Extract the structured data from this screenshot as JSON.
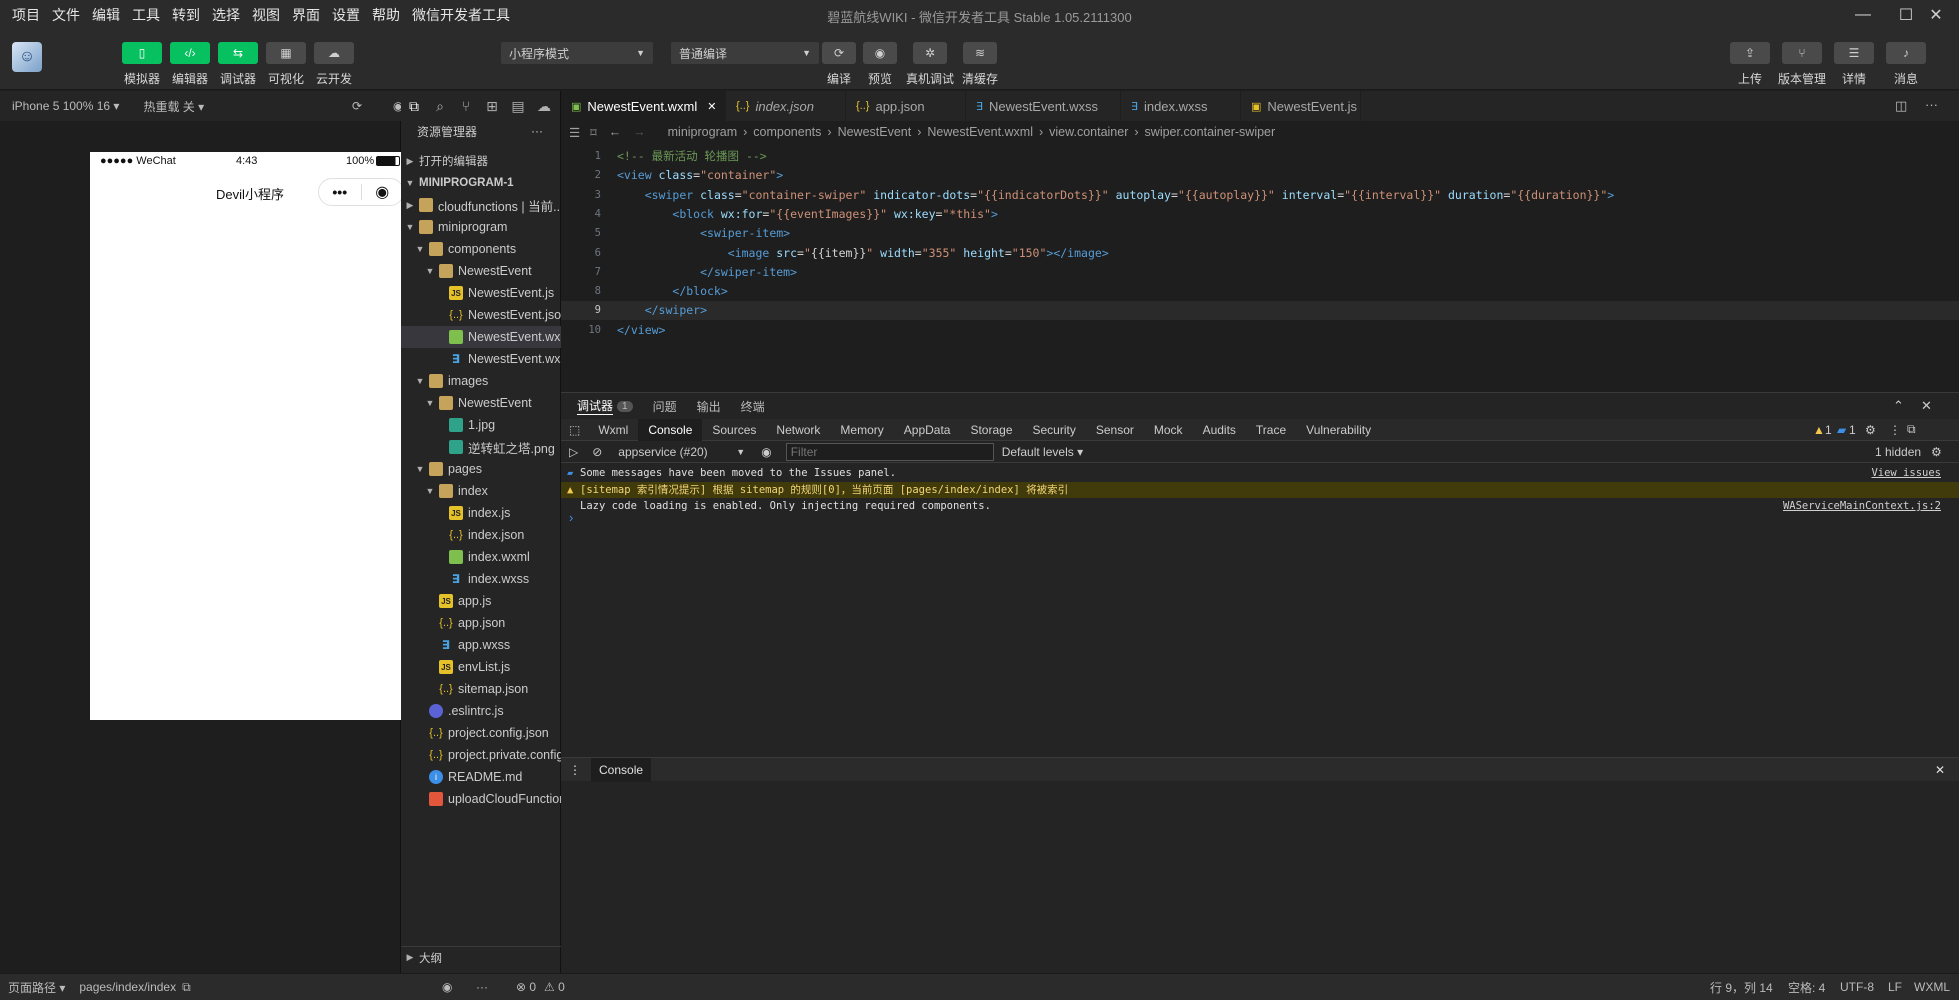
{
  "window": {
    "title": "碧蓝航线WIKI - 微信开发者工具 Stable 1.05.2111300",
    "menu": [
      "项目",
      "文件",
      "编辑",
      "工具",
      "转到",
      "选择",
      "视图",
      "界面",
      "设置",
      "帮助",
      "微信开发者工具"
    ]
  },
  "toolbar": {
    "left_buttons": [
      {
        "label": "模拟器",
        "icon": "phone-icon"
      },
      {
        "label": "编辑器",
        "icon": "code-icon"
      },
      {
        "label": "调试器",
        "icon": "debug-icon"
      },
      {
        "label": "可视化",
        "icon": "layout-icon"
      },
      {
        "label": "云开发",
        "icon": "cloud-icon"
      }
    ],
    "mode_select": "小程序模式",
    "compile_select": "普通编译",
    "center_buttons": [
      {
        "label": "编译",
        "icon": "refresh-icon"
      },
      {
        "label": "预览",
        "icon": "eye-icon"
      },
      {
        "label": "真机调试",
        "icon": "bug-icon"
      },
      {
        "label": "清缓存",
        "icon": "layers-icon"
      }
    ],
    "right_buttons": [
      {
        "label": "上传",
        "icon": "upload-icon"
      },
      {
        "label": "版本管理",
        "icon": "branch-icon"
      },
      {
        "label": "详情",
        "icon": "menu-icon"
      },
      {
        "label": "消息",
        "icon": "bell-icon"
      }
    ]
  },
  "simulator": {
    "device": "iPhone 5 100% 16 ▾",
    "hot_reload": "热重载 关 ▾",
    "status_signal": "●●●●● WeChat",
    "status_time": "4:43",
    "status_battery": "100%",
    "nav_title": "Devil小程序",
    "capsule_dots": "•••"
  },
  "explorer": {
    "title": "资源管理器",
    "more": "···",
    "open_editors": "打开的编辑器",
    "project": "MINIPROGRAM-1",
    "outline": "大纲",
    "tree": [
      {
        "name": "cloudfunctions | 当前...",
        "type": "folder",
        "depth": 1,
        "open": false
      },
      {
        "name": "miniprogram",
        "type": "folder",
        "depth": 1,
        "open": true
      },
      {
        "name": "components",
        "type": "folder",
        "depth": 2,
        "open": true
      },
      {
        "name": "NewestEvent",
        "type": "folder",
        "depth": 3,
        "open": true
      },
      {
        "name": "NewestEvent.js",
        "type": "js",
        "depth": 4
      },
      {
        "name": "NewestEvent.json",
        "type": "json",
        "depth": 4
      },
      {
        "name": "NewestEvent.wxml",
        "type": "wxml",
        "depth": 4,
        "selected": true
      },
      {
        "name": "NewestEvent.wxss",
        "type": "wxss",
        "depth": 4
      },
      {
        "name": "images",
        "type": "folder",
        "depth": 2,
        "open": true
      },
      {
        "name": "NewestEvent",
        "type": "folder",
        "depth": 3,
        "open": true
      },
      {
        "name": "1.jpg",
        "type": "img",
        "depth": 4
      },
      {
        "name": "逆转虹之塔.png",
        "type": "img",
        "depth": 4
      },
      {
        "name": "pages",
        "type": "folder",
        "depth": 2,
        "open": true
      },
      {
        "name": "index",
        "type": "folder",
        "depth": 3,
        "open": true
      },
      {
        "name": "index.js",
        "type": "js",
        "depth": 4
      },
      {
        "name": "index.json",
        "type": "json",
        "depth": 4
      },
      {
        "name": "index.wxml",
        "type": "wxml",
        "depth": 4
      },
      {
        "name": "index.wxss",
        "type": "wxss",
        "depth": 4
      },
      {
        "name": "app.js",
        "type": "js",
        "depth": 3
      },
      {
        "name": "app.json",
        "type": "json",
        "depth": 3
      },
      {
        "name": "app.wxss",
        "type": "wxss",
        "depth": 3
      },
      {
        "name": "envList.js",
        "type": "js",
        "depth": 3
      },
      {
        "name": "sitemap.json",
        "type": "json",
        "depth": 3
      },
      {
        "name": ".eslintrc.js",
        "type": "eslint",
        "depth": 2
      },
      {
        "name": "project.config.json",
        "type": "json",
        "depth": 2
      },
      {
        "name": "project.private.config.js...",
        "type": "json",
        "depth": 2
      },
      {
        "name": "README.md",
        "type": "info",
        "depth": 2
      },
      {
        "name": "uploadCloudFunction....",
        "type": "html",
        "depth": 2
      }
    ]
  },
  "editor": {
    "tabs": [
      {
        "name": "NewestEvent.wxml",
        "type": "wxml",
        "active": true,
        "close": "✕"
      },
      {
        "name": "index.json",
        "type": "json",
        "italic": true
      },
      {
        "name": "app.json",
        "type": "json"
      },
      {
        "name": "NewestEvent.wxss",
        "type": "wxss"
      },
      {
        "name": "index.wxss",
        "type": "wxss"
      },
      {
        "name": "NewestEvent.js",
        "type": "js"
      }
    ],
    "breadcrumb": [
      "miniprogram",
      "components",
      "NewestEvent",
      "NewestEvent.wxml",
      "view.container",
      "swiper.container-swiper"
    ],
    "lines": [
      {
        "n": "1",
        "tokens": [
          [
            "c-com",
            "<!-- 最新活动 轮播图 -->"
          ]
        ]
      },
      {
        "n": "2",
        "tokens": [
          [
            "c-tag",
            "<view "
          ],
          [
            "c-attr",
            "class"
          ],
          [
            "c-txt",
            "="
          ],
          [
            "c-str",
            "\"container\""
          ],
          [
            "c-tag",
            ">"
          ]
        ]
      },
      {
        "n": "3",
        "tokens": [
          [
            "c-txt",
            "    "
          ],
          [
            "c-tag",
            "<swiper "
          ],
          [
            "c-attr",
            "class"
          ],
          [
            "c-txt",
            "="
          ],
          [
            "c-str",
            "\"container-swiper\""
          ],
          [
            "c-txt",
            " "
          ],
          [
            "c-attr",
            "indicator-dots"
          ],
          [
            "c-txt",
            "="
          ],
          [
            "c-str",
            "\"{{indicatorDots}}\""
          ],
          [
            "c-txt",
            " "
          ],
          [
            "c-attr",
            "autoplay"
          ],
          [
            "c-txt",
            "="
          ],
          [
            "c-str",
            "\"{{autoplay}}\""
          ],
          [
            "c-txt",
            " "
          ],
          [
            "c-attr",
            "interval"
          ],
          [
            "c-txt",
            "="
          ],
          [
            "c-str",
            "\"{{interval}}\""
          ],
          [
            "c-txt",
            " "
          ],
          [
            "c-attr",
            "duration"
          ],
          [
            "c-txt",
            "="
          ],
          [
            "c-str",
            "\"{{duration}}\""
          ],
          [
            "c-tag",
            ">"
          ]
        ]
      },
      {
        "n": "4",
        "tokens": [
          [
            "c-txt",
            "        "
          ],
          [
            "c-tag",
            "<block "
          ],
          [
            "c-attr",
            "wx:for"
          ],
          [
            "c-txt",
            "="
          ],
          [
            "c-str",
            "\"{{eventImages}}\""
          ],
          [
            "c-txt",
            " "
          ],
          [
            "c-attr",
            "wx:key"
          ],
          [
            "c-txt",
            "="
          ],
          [
            "c-str",
            "\"*this\""
          ],
          [
            "c-tag",
            ">"
          ]
        ]
      },
      {
        "n": "5",
        "tokens": [
          [
            "c-txt",
            "            "
          ],
          [
            "c-tag",
            "<swiper-item>"
          ]
        ]
      },
      {
        "n": "6",
        "tokens": [
          [
            "c-txt",
            "                "
          ],
          [
            "c-tag",
            "<image "
          ],
          [
            "c-attr",
            "src"
          ],
          [
            "c-txt",
            "="
          ],
          [
            "c-str",
            "\""
          ],
          [
            "c-txt",
            "{{item}}"
          ],
          [
            "c-str",
            "\""
          ],
          [
            "c-txt",
            " "
          ],
          [
            "c-attr",
            "width"
          ],
          [
            "c-txt",
            "="
          ],
          [
            "c-str",
            "\"355\""
          ],
          [
            "c-txt",
            " "
          ],
          [
            "c-attr",
            "height"
          ],
          [
            "c-txt",
            "="
          ],
          [
            "c-str",
            "\"150\""
          ],
          [
            "c-tag",
            "></image>"
          ]
        ]
      },
      {
        "n": "7",
        "tokens": [
          [
            "c-txt",
            "            "
          ],
          [
            "c-tag",
            "</swiper-item>"
          ]
        ]
      },
      {
        "n": "8",
        "tokens": [
          [
            "c-txt",
            "        "
          ],
          [
            "c-tag",
            "</block>"
          ]
        ]
      },
      {
        "n": "9",
        "tokens": [
          [
            "c-txt",
            "    "
          ],
          [
            "c-tag",
            "</swiper>"
          ]
        ]
      },
      {
        "n": "10",
        "tokens": [
          [
            "c-tag",
            "</view>"
          ]
        ]
      }
    ]
  },
  "debugger": {
    "tabs": [
      "调试器",
      "问题",
      "输出",
      "终端"
    ],
    "badge": "1",
    "devtools_tabs": [
      "Wxml",
      "Console",
      "Sources",
      "Network",
      "Memory",
      "AppData",
      "Storage",
      "Security",
      "Sensor",
      "Mock",
      "Audits",
      "Trace",
      "Vulnerability"
    ],
    "warn_count": "1",
    "info_count": "1",
    "context": "appservice (#20)",
    "filter_placeholder": "Filter",
    "levels": "Default levels ▾",
    "hidden": "1 hidden",
    "messages": [
      {
        "text": "Some messages have been moved to the Issues panel.",
        "link": "View issues",
        "level": "info"
      },
      {
        "text": "[sitemap 索引情况提示] 根据 sitemap 的规则[0]，当前页面 [pages/index/index] 将被索引",
        "link": "",
        "level": "warn"
      },
      {
        "text": "Lazy code loading is enabled. Only injecting required components.",
        "link": "WAServiceMainContext.js:2",
        "level": "log"
      }
    ],
    "prompt": "›",
    "drawer_tab": "Console"
  },
  "statusbar": {
    "page_path_label": "页面路径 ▾",
    "page_path": "pages/index/index",
    "errors": "⊗ 0",
    "warnings": "⚠ 0",
    "cursor": "行 9，列 14",
    "indent": "空格: 4",
    "encoding": "UTF-8",
    "eol": "LF",
    "language": "WXML"
  },
  "colors": {
    "accent_green": "#07c160",
    "editor_bg": "#1e1e1e",
    "sidebar_bg": "#252526",
    "warn_bg": "#413a0b"
  }
}
